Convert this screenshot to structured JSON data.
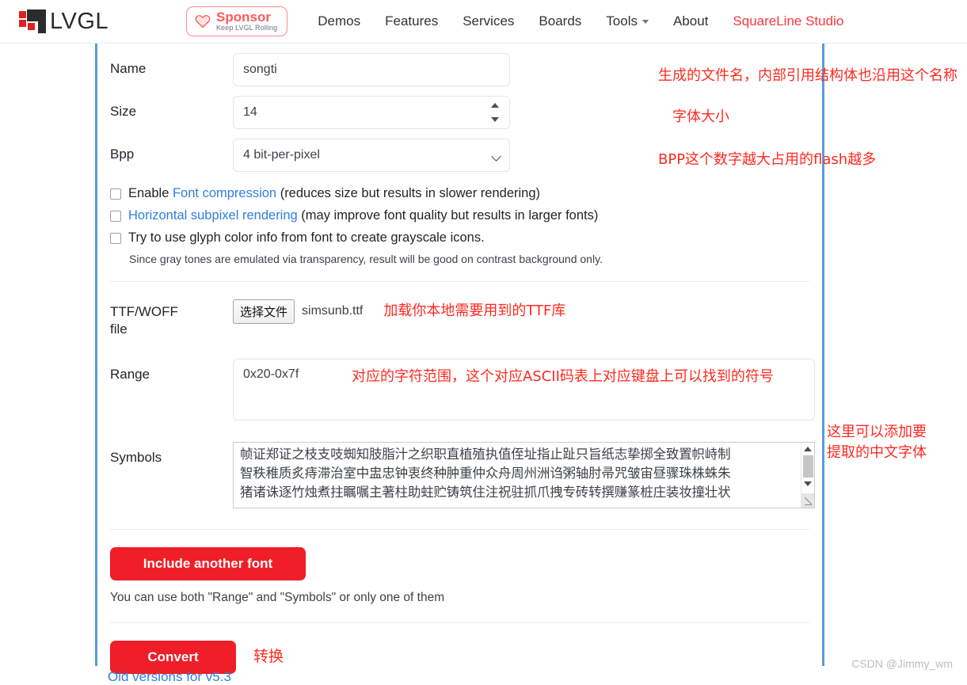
{
  "header": {
    "brand": "LVGL",
    "sponsor": {
      "title": "Sponsor",
      "subtitle": "Keep LVGL Rolling"
    },
    "nav": [
      {
        "label": "Demos",
        "accent": false,
        "caret": false
      },
      {
        "label": "Features",
        "accent": false,
        "caret": false
      },
      {
        "label": "Services",
        "accent": false,
        "caret": false
      },
      {
        "label": "Boards",
        "accent": false,
        "caret": false
      },
      {
        "label": "Tools",
        "accent": false,
        "caret": true
      },
      {
        "label": "About",
        "accent": false,
        "caret": false
      },
      {
        "label": "SquareLine Studio",
        "accent": true,
        "caret": false
      }
    ]
  },
  "form": {
    "name": {
      "label": "Name",
      "value": "songti",
      "annotation": "生成的文件名，内部引用结构体也沿用这个名称"
    },
    "size": {
      "label": "Size",
      "value": "14",
      "annotation": "字体大小"
    },
    "bpp": {
      "label": "Bpp",
      "value": "4 bit-per-pixel",
      "annotation": "BPP这个数字越大占用的flash越多"
    },
    "checkboxes": [
      {
        "prefix": "Enable ",
        "link": "Font compression",
        "suffix": " (reduces size but results in slower rendering)",
        "checked": false
      },
      {
        "prefix": "",
        "link": "Horizontal subpixel rendering",
        "suffix": " (may improve font quality but results in larger fonts)",
        "checked": false
      },
      {
        "prefix": "Try to use glyph color info from font to create grayscale icons.",
        "link": "",
        "suffix": "",
        "checked": false
      }
    ],
    "checkbox_note": "Since gray tones are emulated via transparency, result will be good on contrast background only.",
    "file": {
      "label_line1": "TTF/WOFF",
      "label_line2": "file",
      "button": "选择文件",
      "filename": "simsunb.ttf",
      "annotation": "加载你本地需要用到的TTF库"
    },
    "range": {
      "label": "Range",
      "value": "0x20-0x7f",
      "annotation": "对应的字符范围，这个对应ASCII码表上对应键盘上可以找到的符号"
    },
    "symbols": {
      "label": "Symbols",
      "line1": "帧证郑证之枝支吱蜘知肢脂汁之织职直植殖执值侄址指止趾只旨纸志挚掷全致置帜峙制",
      "line2": "智秩稚质炙痔滞治室中盅忠钟衷终种肿重仲众舟周州洲诌粥轴肘帚咒皱宙昼骤珠株蛛朱",
      "line3": "猪诸诛逐竹烛煮拄瞩嘱主著柱助蛀贮铸筑住注祝驻抓爪拽专砖转撰赚篆桩庄装妆撞壮状",
      "annotation_line1": "这里可以添加要",
      "annotation_line2": "提取的中文字体"
    },
    "include_button": "Include another font",
    "helper_text": "You can use both \"Range\" and \"Symbols\" or only one of them",
    "convert_button": "Convert",
    "convert_annotation": "转换"
  },
  "footer": {
    "old_versions_link": "Old versions for v5.3",
    "watermark": "CSDN @Jimmy_wm"
  }
}
